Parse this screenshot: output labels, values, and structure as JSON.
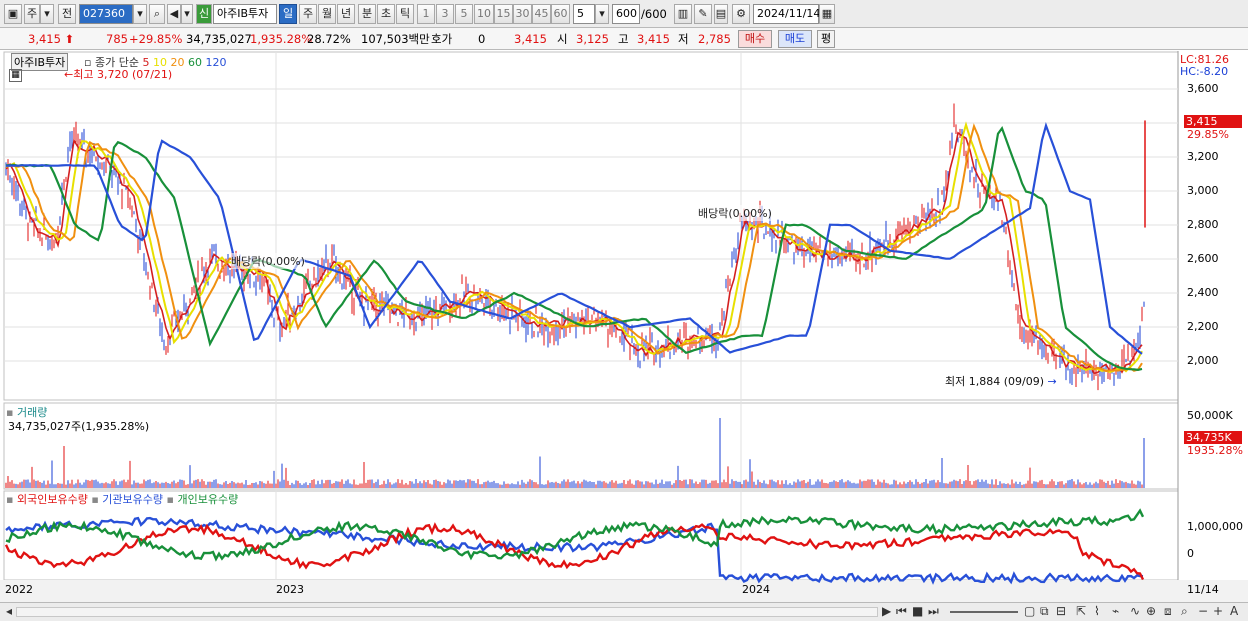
{
  "toolbar": {
    "market_options": [
      "주",
      "전"
    ],
    "code": "027360",
    "credit_badge": "신",
    "stock_name": "아주IB투자",
    "periods": [
      "일",
      "주",
      "월",
      "년",
      "분",
      "초",
      "틱"
    ],
    "selected_period": "일",
    "intervals": [
      "1",
      "3",
      "5",
      "10",
      "15",
      "30",
      "45",
      "60"
    ],
    "interval_value": "5",
    "count": "600",
    "count_total": "/600",
    "date": "2024/11/14"
  },
  "quote": {
    "price": "3,415",
    "change": "785",
    "change_pct": "+29.85%",
    "volume": "34,735,027",
    "volume_pct": "1,935.28%",
    "turnover": "28.72%",
    "amount": "107,503백만",
    "hoga_label": "호가",
    "hoga_value": "0",
    "hoga_price": "3,415",
    "open_label": "시",
    "open": "3,125",
    "high_label": "고",
    "high": "3,415",
    "low_label": "저",
    "low": "2,785",
    "buy_label": "매수",
    "sell_label": "매도",
    "avg_label": "평"
  },
  "price_panel": {
    "name_badge": "아주IB투자",
    "ma_label": "종가 단순",
    "ma_periods": [
      {
        "p": "5",
        "color": "#d42020"
      },
      {
        "p": "10",
        "color": "#e8e000"
      },
      {
        "p": "20",
        "color": "#f09010"
      },
      {
        "p": "60",
        "color": "#18903a"
      },
      {
        "p": "120",
        "color": "#2850d8"
      }
    ],
    "high_note": "최고 3,720 (07/21)",
    "low_note": "최저 1,884 (09/09)",
    "dividend_note_1": "배당락(0.00%)",
    "dividend_note_2": "배당락(0.00%)",
    "lc": "LC:81.26",
    "hc": "HC:-8.20",
    "yticks": [
      "3,600",
      "3,400",
      "3,200",
      "3,000",
      "2,800",
      "2,600",
      "2,400",
      "2,200",
      "2,000"
    ],
    "current_tag": "3,415",
    "current_pct": "29.85%"
  },
  "volume_panel": {
    "title": "거래량",
    "summary": "34,735,027주(1,935.28%)",
    "ytick": "50,000K",
    "current_tag": "34,735K",
    "current_pct": "1935.28%"
  },
  "holding_panel": {
    "legend": [
      {
        "name": "외국인보유수량",
        "color": "#e01212"
      },
      {
        "name": "기관보유수량",
        "color": "#2850d8"
      },
      {
        "name": "개인보유수량",
        "color": "#18903a"
      }
    ],
    "yticks": [
      "1,000,000",
      "0"
    ]
  },
  "x_axis": {
    "labels": [
      "2022",
      "2023",
      "2024"
    ],
    "last_date": "11/14"
  },
  "colors": {
    "up": "#e01212",
    "down": "#1a3fd6",
    "selected": "#2b6cc4"
  }
}
